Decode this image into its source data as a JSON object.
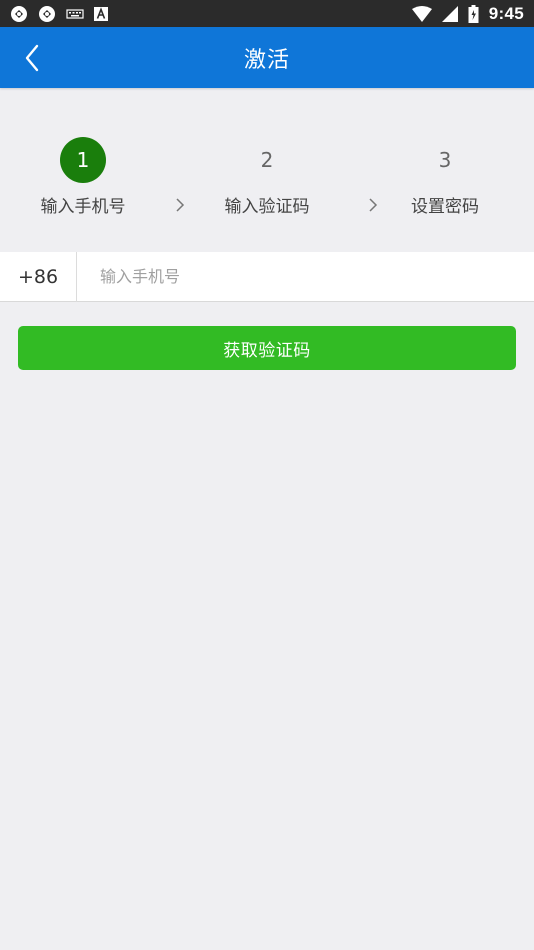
{
  "status_bar": {
    "time": "9:45",
    "icons": [
      "notification-icon",
      "notification-icon",
      "keyboard-icon",
      "a-icon",
      "wifi-icon",
      "signal-icon",
      "battery-icon"
    ]
  },
  "app_bar": {
    "title": "激活",
    "back_icon": "chevron-left-icon",
    "color": "#0f76d8"
  },
  "steps": [
    {
      "number": "1",
      "label": "输入手机号",
      "active": true
    },
    {
      "number": "2",
      "label": "输入验证码",
      "active": false
    },
    {
      "number": "3",
      "label": "设置密码",
      "active": false
    }
  ],
  "phone": {
    "country_code": "+86",
    "placeholder": "输入手机号",
    "value": ""
  },
  "get_code_button": {
    "label": "获取验证码",
    "color": "#32bb24"
  },
  "colors": {
    "background": "#efeff2",
    "active_step": "#1a7e0c"
  }
}
